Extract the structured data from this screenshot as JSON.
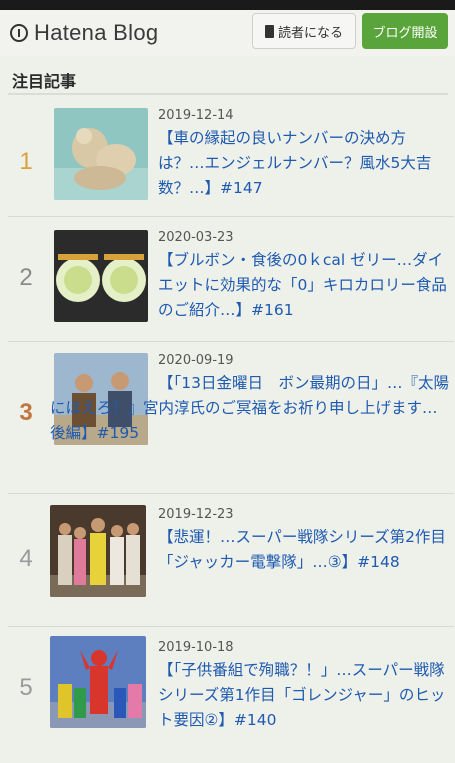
{
  "header": {
    "logo_text": "Hatena Blog",
    "subscribe_label": "読者になる",
    "start_blog_label": "ブログ開設"
  },
  "section": {
    "title": "注目記事"
  },
  "items": [
    {
      "rank": "1",
      "date": "2019-12-14",
      "title": "【車の縁起の良いナンバーの決め方は？…エンジェルナンバー？風水5大吉数？…】#147",
      "rank_color": "#d9a23a"
    },
    {
      "rank": "2",
      "date": "2020-03-23",
      "title": "【ブルボン・食後の0ｋcal ゼリー…ダイエットに効果的な「0」キロカロリー食品のご紹介…】#161",
      "rank_color": "#8a8a8a"
    },
    {
      "rank": "3",
      "date": "2020-09-19",
      "title": "【「13日金曜日　ボン最期の日」…『太陽にほえろ！』宮内淳氏のご冥福をお祈り申し上げます…後編】#195",
      "rank_color": "#c0763e"
    },
    {
      "rank": "4",
      "date": "2019-12-23",
      "title": "【悲運！…スーパー戦隊シリーズ第2作目「ジャッカー電撃隊」…③】#148",
      "rank_color": "#9a9a9a"
    },
    {
      "rank": "5",
      "date": "2019-10-18",
      "title": "【「子供番組で殉職？！」…スーパー戦隊シリーズ第1作目「ゴレンジャー」のヒット要因②】#140",
      "rank_color": "#9a9a9a"
    }
  ]
}
